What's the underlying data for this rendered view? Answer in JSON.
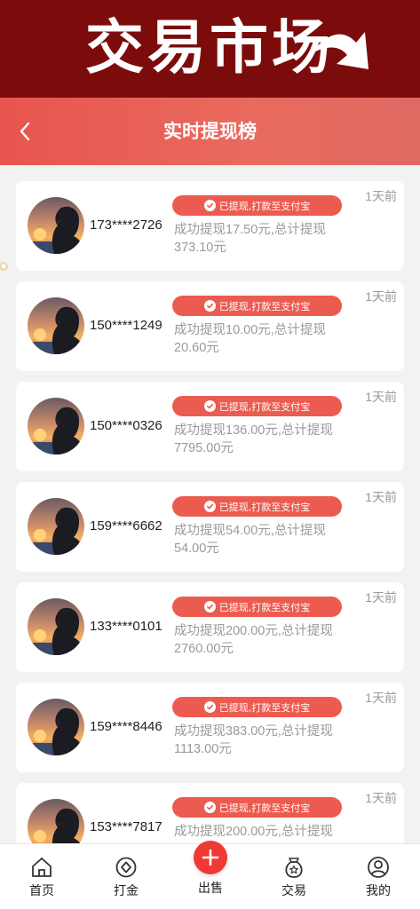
{
  "banner": {
    "text": "交易市场"
  },
  "header": {
    "title": "实时提现榜"
  },
  "records": [
    {
      "phone": "173****2726",
      "badge": "已提现,打款至支付宝",
      "desc": "成功提现17.50元,总计提现373.10元",
      "time": "1天前"
    },
    {
      "phone": "150****1249",
      "badge": "已提现,打款至支付宝",
      "desc": "成功提现10.00元,总计提现20.60元",
      "time": "1天前"
    },
    {
      "phone": "150****0326",
      "badge": "已提现,打款至支付宝",
      "desc": "成功提现136.00元,总计提现7795.00元",
      "time": "1天前"
    },
    {
      "phone": "159****6662",
      "badge": "已提现,打款至支付宝",
      "desc": "成功提现54.00元,总计提现54.00元",
      "time": "1天前"
    },
    {
      "phone": "133****0101",
      "badge": "已提现,打款至支付宝",
      "desc": "成功提现200.00元,总计提现2760.00元",
      "time": "1天前"
    },
    {
      "phone": "159****8446",
      "badge": "已提现,打款至支付宝",
      "desc": "成功提现383.00元,总计提现1113.00元",
      "time": "1天前"
    },
    {
      "phone": "153****7817",
      "badge": "已提现,打款至支付宝",
      "desc": "成功提现200.00元,总计提现",
      "time": "1天前"
    }
  ],
  "tabs": [
    {
      "label": "首页",
      "icon": "home-icon"
    },
    {
      "label": "打金",
      "icon": "diamond-coin-icon"
    },
    {
      "label": "出售",
      "icon": "plus-icon"
    },
    {
      "label": "交易",
      "icon": "star-bag-icon"
    },
    {
      "label": "我的",
      "icon": "user-icon"
    }
  ],
  "colors": {
    "banner": "#7c0c0c",
    "accent": "#ec5b4f",
    "header": "#e8554f"
  }
}
